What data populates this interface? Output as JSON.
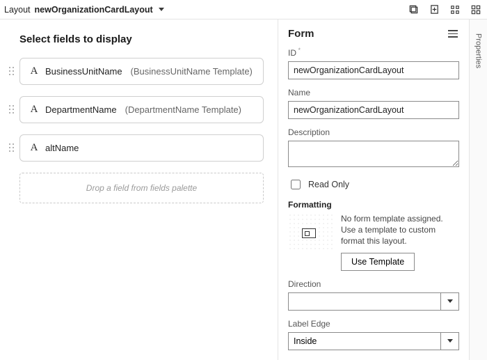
{
  "topbar": {
    "layout_prefix": "Layout",
    "layout_name": "newOrganizationCardLayout"
  },
  "canvas": {
    "heading": "Select fields to display",
    "fields": [
      {
        "name": "BusinessUnitName",
        "template": "(BusinessUnitName Template)"
      },
      {
        "name": "DepartmentName",
        "template": "(DepartmentName Template)"
      },
      {
        "name": "altName",
        "template": ""
      }
    ],
    "dropzone_text": "Drop a field from fields palette"
  },
  "panel": {
    "title": "Form",
    "id": {
      "label": "ID",
      "value": "newOrganizationCardLayout"
    },
    "name": {
      "label": "Name",
      "value": "newOrganizationCardLayout"
    },
    "desc": {
      "label": "Description",
      "value": ""
    },
    "readonly": {
      "label": "Read Only",
      "checked": false
    },
    "formatting": {
      "label": "Formatting",
      "message": "No form template assigned. Use a template to custom format this layout.",
      "button": "Use Template"
    },
    "direction": {
      "label": "Direction",
      "value": ""
    },
    "label_edge": {
      "label": "Label Edge",
      "value": "Inside"
    }
  },
  "rail": {
    "label": "Properties"
  }
}
